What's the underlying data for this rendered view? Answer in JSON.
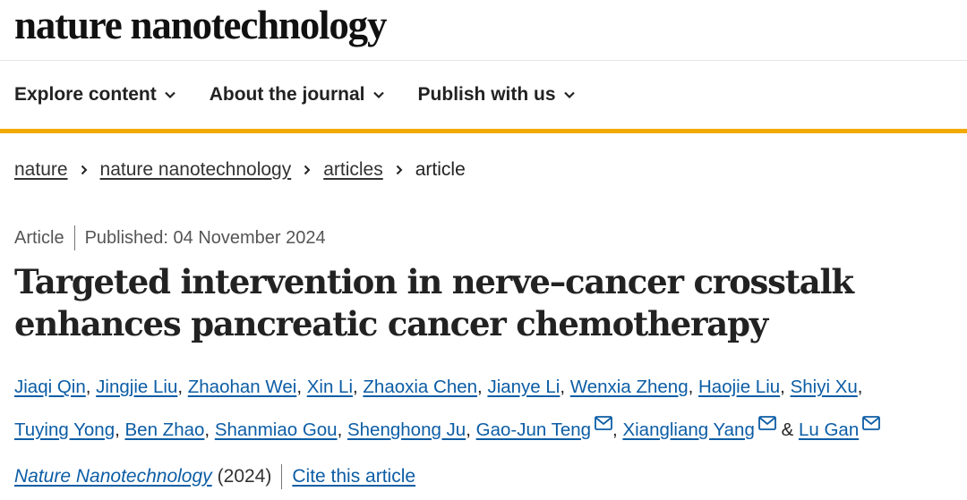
{
  "site": {
    "logo": "nature nanotechnology"
  },
  "nav": {
    "items": [
      "Explore content",
      "About the journal",
      "Publish with us"
    ],
    "accent_color": "#f2a900"
  },
  "breadcrumb": {
    "links": [
      "nature",
      "nature nanotechnology",
      "articles"
    ],
    "current": "article"
  },
  "article": {
    "type": "Article",
    "published": "Published: 04 November 2024",
    "title_line1": "Targeted intervention in nerve–cancer crosstalk",
    "title_line2": "enhances pancreatic cancer chemotherapy",
    "authors": [
      "Jiaqi Qin",
      "Jingjie Liu",
      "Zhaohan Wei",
      "Xin Li",
      "Zhaoxia Chen",
      "Jianye Li",
      "Wenxia Zheng",
      "Haojie Liu",
      "Shiyi Xu",
      "Tuying Yong",
      "Ben Zhao",
      "Shanmiao Gou",
      "Shenghong Ju",
      "Gao-Jun Teng",
      "Xiangliang Yang",
      "Lu Gan"
    ],
    "authors_and": "&",
    "journal": "Nature Nanotechnology",
    "year": "(2024)",
    "cite": "Cite this article",
    "link_color": "#0c5da5"
  }
}
